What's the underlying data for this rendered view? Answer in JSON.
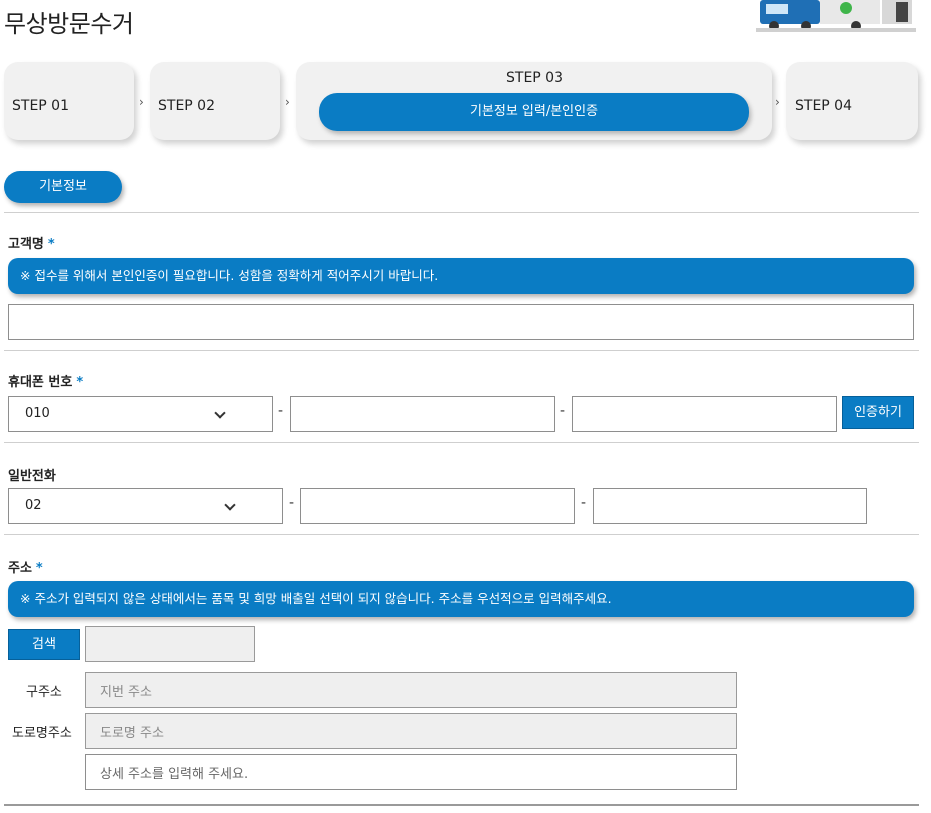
{
  "page": {
    "title": "무상방문수거"
  },
  "steps": {
    "step1": "STEP 01",
    "step2": "STEP 02",
    "step3": "STEP 03",
    "step3_sub": "기본정보 입력/본인인증",
    "step4": "STEP 04",
    "arrow": "›"
  },
  "section": {
    "basic_info": "기본정보"
  },
  "customer": {
    "label": "고객명",
    "required": "*",
    "notice": "※ 접수를 위해서 본인인증이 필요합니다. 성함을 정확하게 적어주시기 바랍니다.",
    "value": ""
  },
  "mobile": {
    "label": "휴대폰 번호",
    "required": "*",
    "prefix": "010",
    "dash": "-",
    "verify_button": "인증하기"
  },
  "phone": {
    "label": "일반전화",
    "prefix": "02",
    "dash": "-"
  },
  "address": {
    "label": "주소",
    "required": "*",
    "notice": "※ 주소가 입력되지 않은 상태에서는 품목 및 희망 배출일 선택이 되지 않습니다. 주소를 우선적으로 입력해주세요.",
    "search_button": "검색",
    "old_label": "구주소",
    "old_placeholder": "지번 주소",
    "road_label": "도로명주소",
    "road_placeholder": "도로명 주소",
    "detail_placeholder": "상세 주소를 입력해 주세요."
  },
  "colors": {
    "accent": "#0a7cc4"
  }
}
